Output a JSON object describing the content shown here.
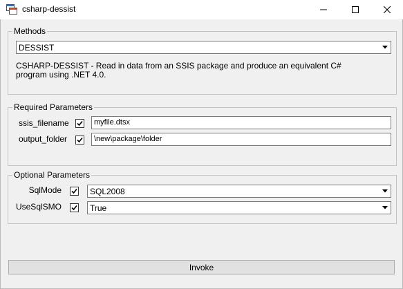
{
  "window": {
    "title": "csharp-dessist",
    "icon": "application-icon"
  },
  "methods": {
    "legend": "Methods",
    "selected": "DESSIST",
    "description": "CSHARP-DESSIST - Read in data from an SSIS package and produce an equivalent C# program using .NET 4.0."
  },
  "required": {
    "legend": "Required Parameters",
    "params": [
      {
        "label": "ssis_filename",
        "checked": true,
        "value": "myfile.dtsx"
      },
      {
        "label": "output_folder",
        "checked": true,
        "value": "\\new\\package\\folder"
      }
    ]
  },
  "optional": {
    "legend": "Optional Parameters",
    "params": [
      {
        "label": "SqlMode",
        "checked": true,
        "value": "SQL2008"
      },
      {
        "label": "UseSqlSMO",
        "checked": true,
        "value": "True"
      }
    ]
  },
  "actions": {
    "invoke_label": "Invoke"
  }
}
